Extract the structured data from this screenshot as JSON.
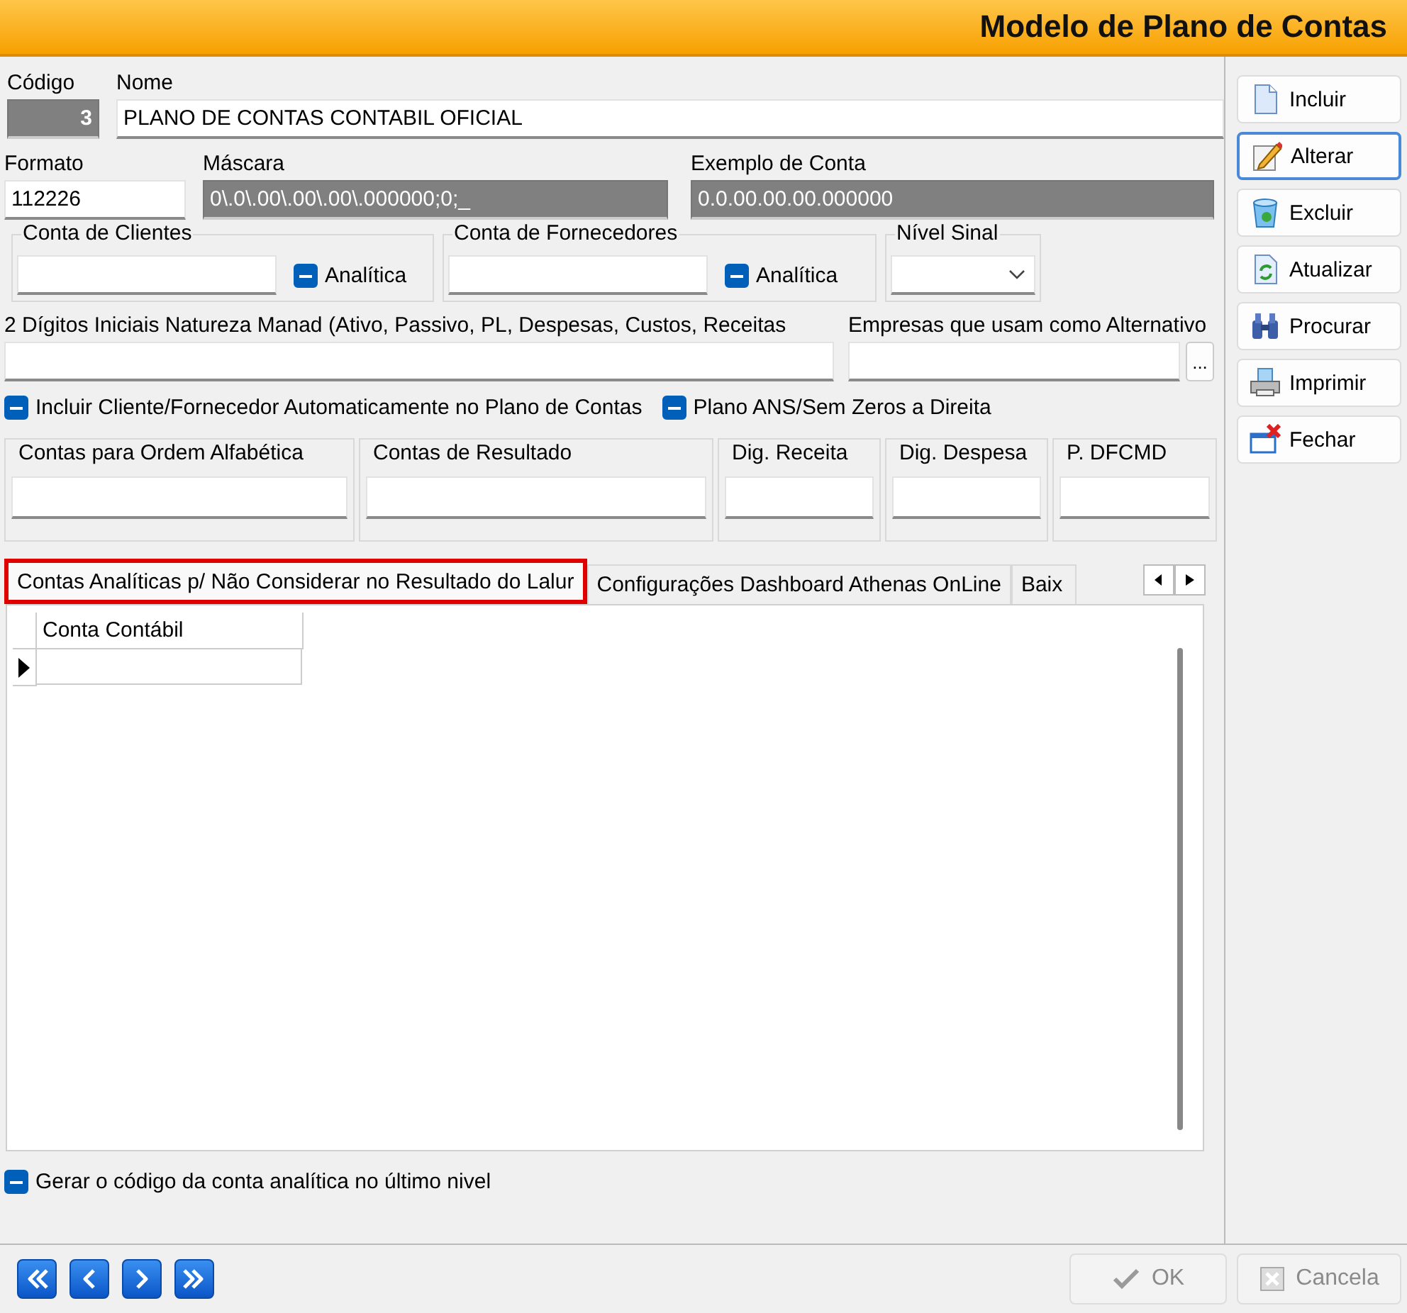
{
  "window": {
    "title": "Modelo de Plano de Contas"
  },
  "codigo": {
    "label": "Código",
    "value": "3"
  },
  "nome": {
    "label": "Nome",
    "value": "PLANO DE CONTAS CONTABIL OFICIAL"
  },
  "formato": {
    "label": "Formato",
    "value": "112226"
  },
  "mascara": {
    "label": "Máscara",
    "value": "0\\.0\\.00\\.00\\.00\\.000000;0;_"
  },
  "exemplo": {
    "label": "Exemplo de Conta",
    "value": "0.0.00.00.00.000000"
  },
  "conta_clientes": {
    "label": "Conta de Clientes",
    "checkbox": {
      "label": "Analítica",
      "checked": true
    }
  },
  "conta_fornecedores": {
    "label": "Conta de Fornecedores",
    "checkbox": {
      "label": "Analítica",
      "checked": true
    }
  },
  "nivel_sinal": {
    "label": "Nível Sinal"
  },
  "digitos": {
    "label": "2 Dígitos Iniciais Natureza Manad (Ativo, Passivo, PL, Despesas, Custos, Receitas"
  },
  "empresas": {
    "label": "Empresas que usam como Alternativo",
    "button": "..."
  },
  "options": [
    {
      "label": "Incluir Cliente/Fornecedor Automaticamente no Plano de Contas",
      "checked": true
    },
    {
      "label": "Plano ANS/Sem Zeros a Direita",
      "checked": true
    }
  ],
  "groups": [
    {
      "label": "Contas para Ordem  Alfabética"
    },
    {
      "label": "Contas de Resultado"
    },
    {
      "label": "Dig. Receita"
    },
    {
      "label": "Dig. Despesa"
    },
    {
      "label": "P. DFCMD"
    }
  ],
  "tabs": [
    {
      "label": "Contas Analíticas p/ Não Considerar no Resultado do Lalur",
      "selected": true,
      "highlighted": true
    },
    {
      "label": "Configurações Dashboard Athenas OnLine",
      "selected": false,
      "highlighted": false
    },
    {
      "label": "Baix",
      "selected": false,
      "highlighted": false
    }
  ],
  "grid": {
    "columns": [
      "Conta Contábil"
    ],
    "rows": [
      {
        "current": true
      }
    ]
  },
  "bottom_option": {
    "label": "Gerar o código da conta analítica no último nivel",
    "checked": true
  },
  "actions": [
    {
      "label": "Incluir",
      "kind": "new",
      "focused": false
    },
    {
      "label": "Alterar",
      "kind": "edit",
      "focused": true
    },
    {
      "label": "Excluir",
      "kind": "delete",
      "focused": false
    },
    {
      "label": "Atualizar",
      "kind": "refresh",
      "focused": false
    },
    {
      "label": "Procurar",
      "kind": "find",
      "focused": false
    },
    {
      "label": "Imprimir",
      "kind": "print",
      "focused": false
    },
    {
      "label": "Fechar",
      "kind": "close",
      "focused": false
    }
  ],
  "nav_buttons": [
    {
      "kind": "first"
    },
    {
      "kind": "prev"
    },
    {
      "kind": "next"
    },
    {
      "kind": "last"
    }
  ],
  "dialog_buttons": [
    {
      "label": "OK",
      "kind": "ok",
      "disabled": true
    },
    {
      "label": "Cancela",
      "kind": "cancel",
      "disabled": true
    }
  ]
}
